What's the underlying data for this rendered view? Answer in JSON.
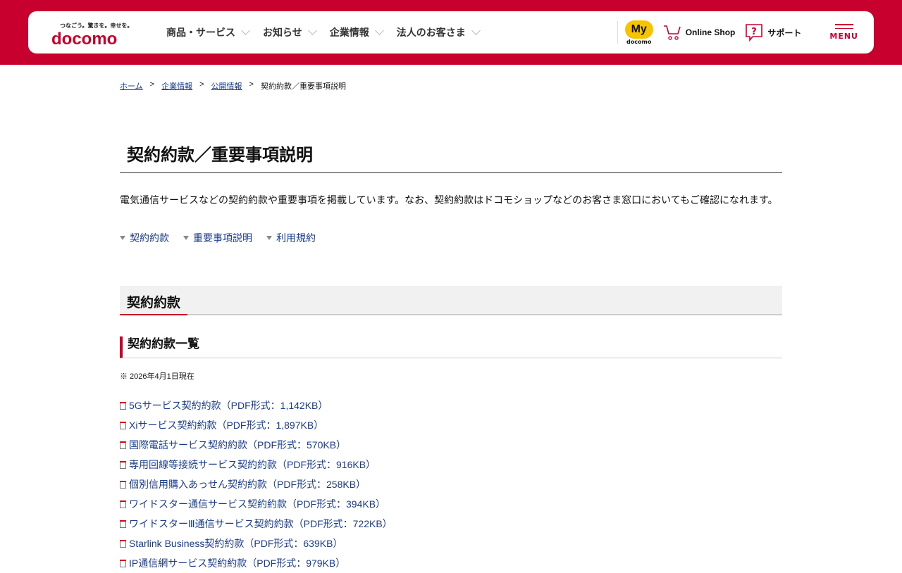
{
  "header": {
    "logo_tagline": "つなごう。驚きを。幸せを。",
    "logo_text": "docomo",
    "nav": [
      {
        "label": "商品・サービス"
      },
      {
        "label": "お知らせ"
      },
      {
        "label": "企業情報"
      },
      {
        "label": "法人のお客さま"
      }
    ],
    "my_badge": "My",
    "my_sub": "docomo",
    "online_shop": "Online Shop",
    "support": "サポート",
    "menu": "MENU",
    "brand_color": "#c8002d"
  },
  "breadcrumb": [
    {
      "label": "ホーム"
    },
    {
      "label": "企業情報"
    },
    {
      "label": "公開情報"
    },
    {
      "label": "契約約款／重要事項説明"
    }
  ],
  "breadcrumb_sep": ">",
  "page": {
    "title": "契約約款／重要事項説明",
    "lead": "電気通信サービスなどの契約約款や重要事項を掲載しています。なお、契約約款はドコモショップなどのお客さま窓口においてもご確認になれます。",
    "anchors": [
      {
        "label": "契約約款"
      },
      {
        "label": "重要事項説明"
      },
      {
        "label": "利用規約"
      }
    ],
    "section_title": "契約約款",
    "subsection_title": "契約約款一覧",
    "note": "※ 2026年4月1日現在",
    "documents": [
      {
        "label": "5Gサービス契約約款（PDF形式：1,142KB）"
      },
      {
        "label": "Xiサービス契約約款（PDF形式：1,897KB）"
      },
      {
        "label": "国際電話サービス契約約款（PDF形式：570KB）"
      },
      {
        "label": "専用回線等接続サービス契約約款（PDF形式：916KB）"
      },
      {
        "label": "個別信用購入あっせん契約約款（PDF形式：258KB）"
      },
      {
        "label": "ワイドスター通信サービス契約約款（PDF形式：394KB）"
      },
      {
        "label": "ワイドスターⅢ通信サービス契約約款（PDF形式：722KB）"
      },
      {
        "label": "Starlink Business契約約款（PDF形式：639KB）"
      },
      {
        "label": "IP通信網サービス契約約款（PDF形式：979KB）"
      }
    ]
  }
}
